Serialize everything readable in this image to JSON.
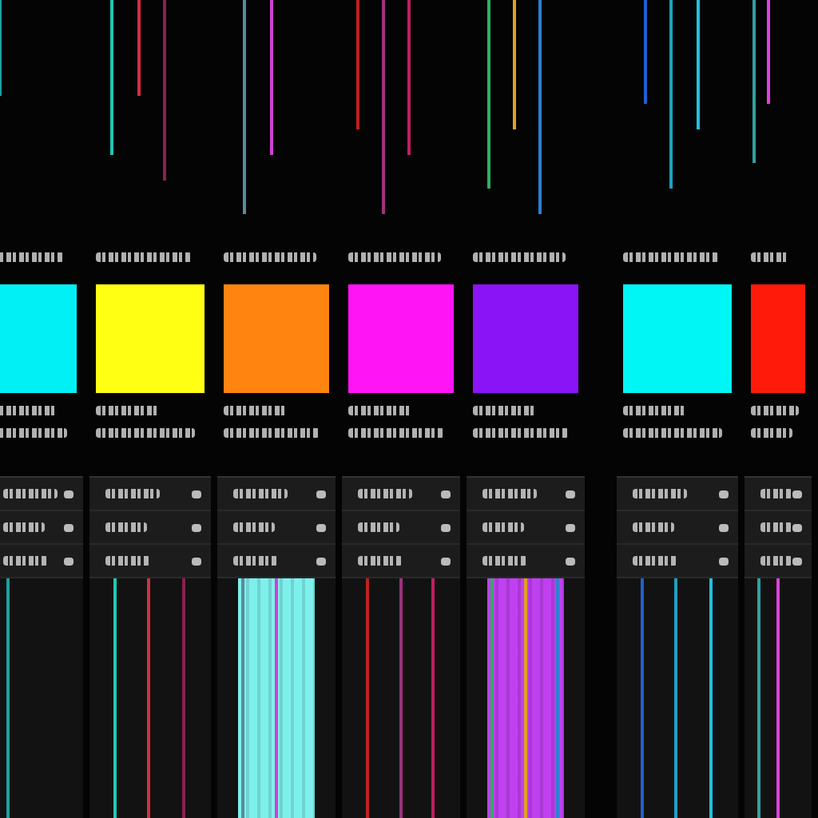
{
  "columns": [
    {
      "swatch": {
        "color": "#00f0f5"
      },
      "streaks": [
        {
          "color": "#1fa0a0"
        }
      ]
    },
    {
      "swatch": {
        "color": "#ffff14"
      },
      "streaks": [
        {
          "color": "#1ec8b4"
        },
        {
          "color": "#d03040"
        },
        {
          "color": "#8a2050"
        }
      ]
    },
    {
      "swatch": {
        "color": "#ff8410"
      },
      "streaks": [
        {
          "color": "#5a8aa0"
        },
        {
          "color": "#d040d0"
        }
      ],
      "fill": {
        "color": "#7ef0ec"
      }
    },
    {
      "swatch": {
        "color": "#ff14f5"
      },
      "streaks": [
        {
          "color": "#c02020"
        },
        {
          "color": "#a03080"
        },
        {
          "color": "#c02060"
        }
      ]
    },
    {
      "swatch": {
        "color": "#8a14f5"
      },
      "streaks": [
        {
          "color": "#30b060"
        },
        {
          "color": "#e0a020"
        },
        {
          "color": "#3080d0"
        }
      ],
      "fill": {
        "color": "#c040f0"
      }
    },
    {
      "swatch": {
        "color": "#00f5f5"
      },
      "streaks": [
        {
          "color": "#2060d0"
        },
        {
          "color": "#20a0c0"
        },
        {
          "color": "#20c0e0"
        }
      ]
    },
    {
      "swatch": {
        "color": "#ff1a0a"
      },
      "streaks": [
        {
          "color": "#30a0a0"
        },
        {
          "color": "#e040e0"
        }
      ]
    }
  ]
}
